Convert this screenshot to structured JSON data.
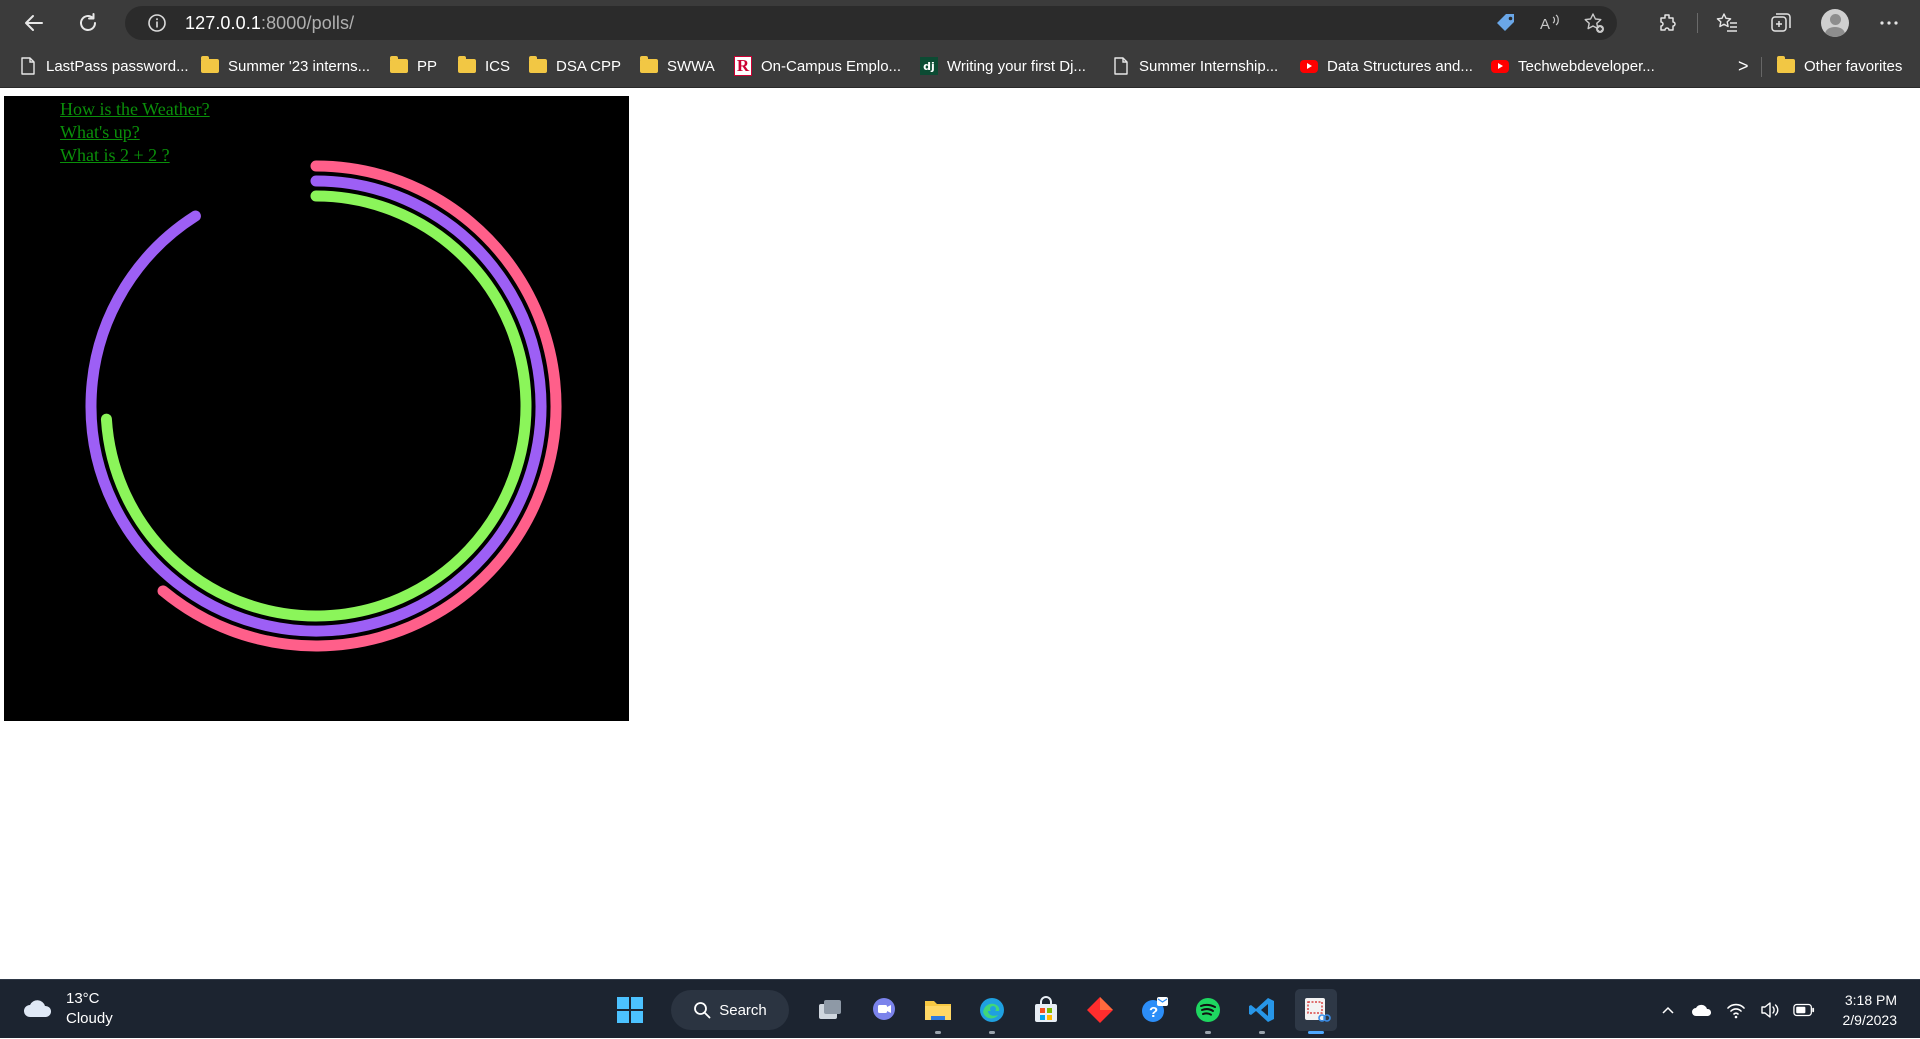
{
  "browser": {
    "url_host": "127.0.0.1",
    "url_path": ":8000/polls/",
    "favorites": [
      {
        "label": "LastPass password...",
        "icon": "page-icon"
      },
      {
        "label": "Summer '23 interns...",
        "icon": "folder-icon"
      },
      {
        "label": "PP",
        "icon": "folder-icon"
      },
      {
        "label": "ICS",
        "icon": "folder-icon"
      },
      {
        "label": "DSA CPP",
        "icon": "folder-icon"
      },
      {
        "label": "SWWA",
        "icon": "folder-icon"
      },
      {
        "label": "On-Campus Emplo...",
        "icon": "rutgers-logo-icon"
      },
      {
        "label": "Writing your first Dj...",
        "icon": "django-icon"
      },
      {
        "label": "Summer Internship...",
        "icon": "page-icon"
      },
      {
        "label": "Data Structures and...",
        "icon": "youtube-icon"
      },
      {
        "label": "Techwebdeveloper...",
        "icon": "youtube-icon"
      }
    ],
    "other_favorites": "Other favorites",
    "overflow_glyph": ">"
  },
  "page": {
    "poll_links": [
      "How is the Weather?",
      "What's up?",
      "What is 2 + 2 ?"
    ],
    "rings": [
      {
        "color": "#ff5f8a",
        "progress": 0.61
      },
      {
        "color": "#9d5ff5",
        "progress": 0.91
      },
      {
        "color": "#8bf55a",
        "progress": 0.74
      }
    ],
    "canvas_color": "#000000",
    "link_color": "#0a8f0a"
  },
  "taskbar": {
    "weather_temp": "13°C",
    "weather_desc": "Cloudy",
    "search_label": "Search",
    "time": "3:18 PM",
    "date": "2/9/2023"
  }
}
